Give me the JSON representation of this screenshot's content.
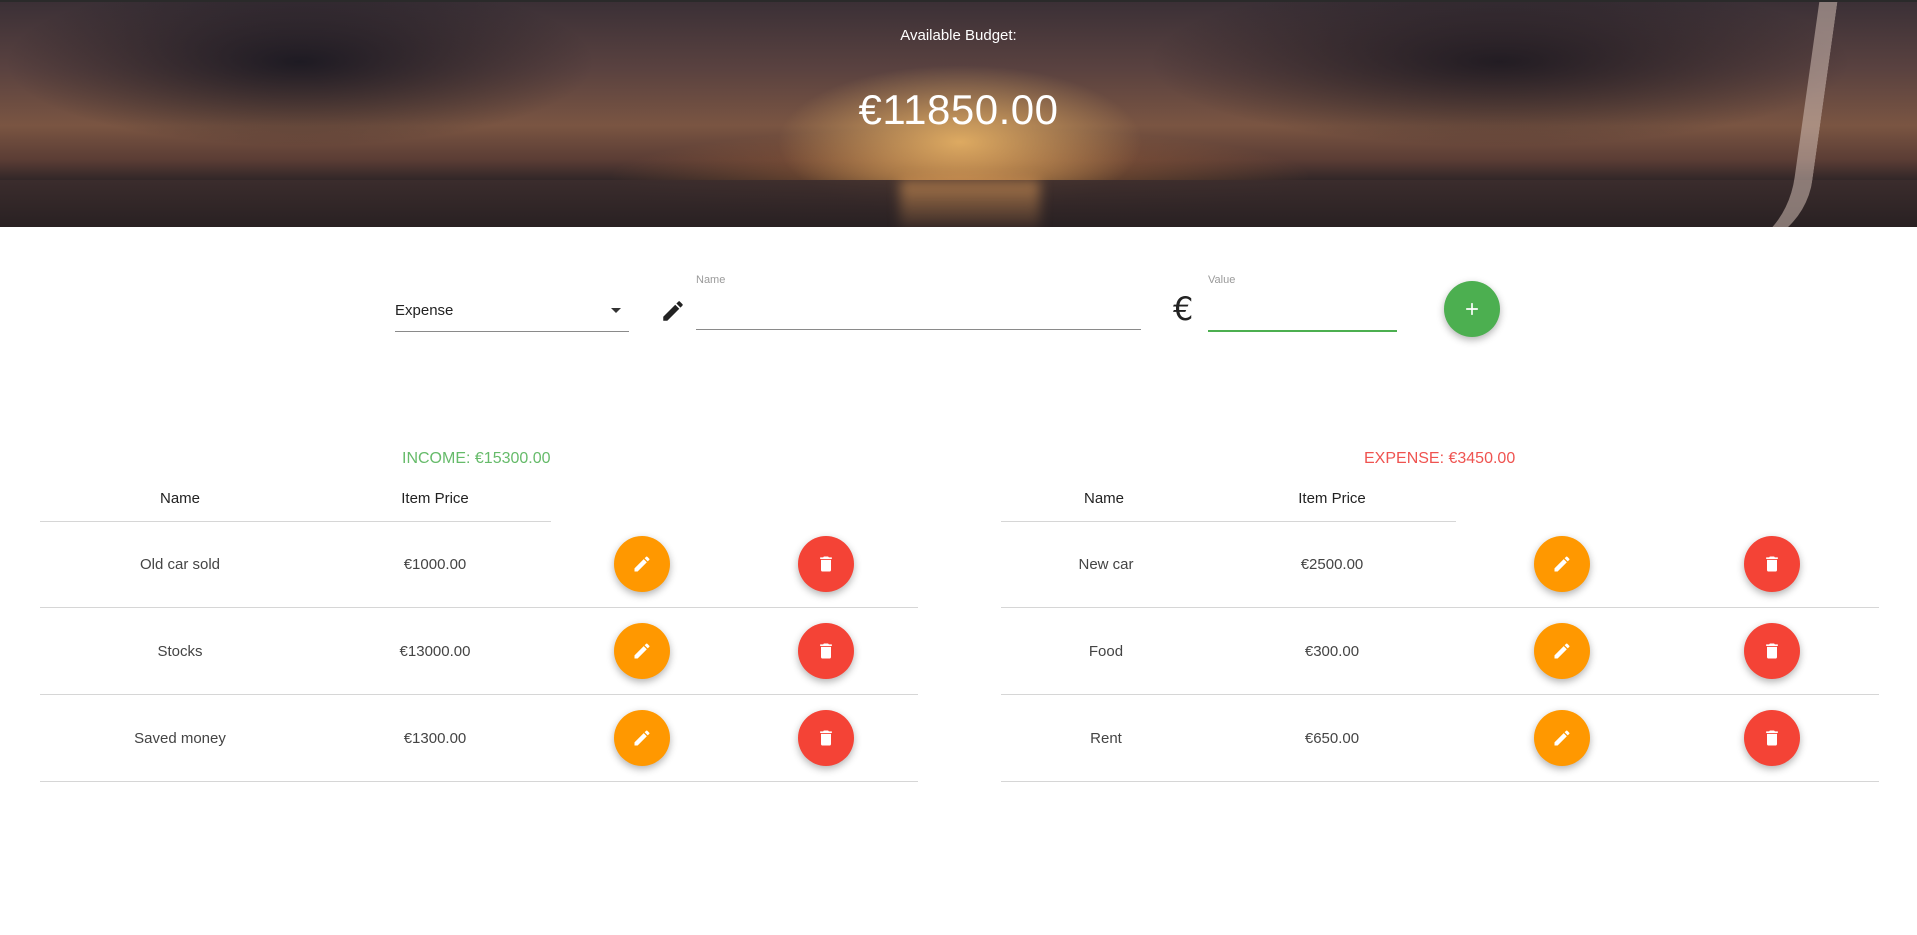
{
  "header": {
    "label": "Available Budget:",
    "amount": "€11850.00"
  },
  "form": {
    "type_selected": "Expense",
    "name_label": "Name",
    "name_value": "",
    "value_label": "Value",
    "value_value": "",
    "currency_symbol": "€",
    "add_button_icon": "plus-icon"
  },
  "income": {
    "title": "INCOME: €15300.00",
    "headers": [
      "Name",
      "Item Price"
    ],
    "rows": [
      {
        "name": "Old car sold",
        "price": "€1000.00"
      },
      {
        "name": "Stocks",
        "price": "€13000.00"
      },
      {
        "name": "Saved money",
        "price": "€1300.00"
      }
    ]
  },
  "expense": {
    "title": "EXPENSE: €3450.00",
    "headers": [
      "Name",
      "Item Price"
    ],
    "rows": [
      {
        "name": "New car",
        "price": "€2500.00"
      },
      {
        "name": "Food",
        "price": "€300.00"
      },
      {
        "name": "Rent",
        "price": "€650.00"
      }
    ]
  },
  "colors": {
    "income": "#66bb6a",
    "expense": "#ef5350",
    "edit_button": "#ff9800",
    "delete_button": "#f44336",
    "add_button": "#4caf50"
  },
  "icons": {
    "edit": "pencil-icon",
    "delete": "trash-icon",
    "name_field": "pencil-icon",
    "value_field": "euro-icon"
  }
}
